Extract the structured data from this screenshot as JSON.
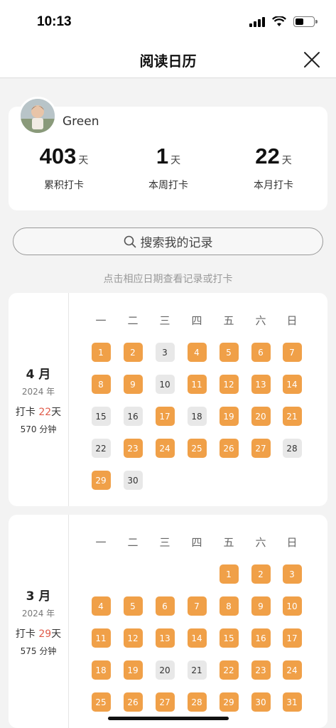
{
  "status": {
    "time": "10:13"
  },
  "nav": {
    "title": "阅读日历"
  },
  "profile": {
    "name": "Green",
    "stats": [
      {
        "value": "403",
        "unit": "天",
        "label": "累积打卡"
      },
      {
        "value": "1",
        "unit": "天",
        "label": "本周打卡"
      },
      {
        "value": "22",
        "unit": "天",
        "label": "本月打卡"
      }
    ]
  },
  "search": {
    "placeholder": "搜索我的记录"
  },
  "hint": "点击相应日期查看记录或打卡",
  "weekdays": [
    "一",
    "二",
    "三",
    "四",
    "五",
    "六",
    "日"
  ],
  "months": [
    {
      "name": "4 月",
      "year": "2024 年",
      "check_prefix": "打卡 ",
      "check_days": "22",
      "check_suffix": "天",
      "minutes": "570 分钟",
      "first_weekday": 0,
      "days": 30,
      "checked": [
        1,
        2,
        4,
        5,
        6,
        7,
        8,
        9,
        11,
        12,
        13,
        14,
        17,
        19,
        20,
        21,
        23,
        24,
        25,
        26,
        27,
        29
      ]
    },
    {
      "name": "3 月",
      "year": "2024 年",
      "check_prefix": "打卡 ",
      "check_days": "29",
      "check_suffix": "天",
      "minutes": "575 分钟",
      "first_weekday": 4,
      "days": 31,
      "checked": [
        1,
        2,
        3,
        4,
        5,
        6,
        7,
        8,
        9,
        10,
        11,
        12,
        13,
        14,
        15,
        16,
        17,
        18,
        19,
        22,
        23,
        24,
        25,
        26,
        27,
        28,
        29,
        30,
        31
      ]
    }
  ],
  "colors": {
    "checked": "#f0a048",
    "unchecked": "#e8e8e8",
    "highlight": "#e05b4a"
  }
}
